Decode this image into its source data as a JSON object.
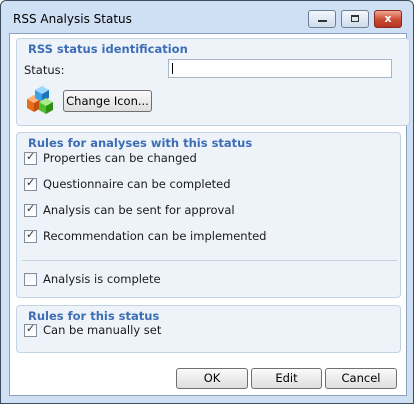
{
  "window": {
    "title": "RSS Analysis Status"
  },
  "titlebar_buttons": {
    "minimize": "–",
    "maximize": "□",
    "close": "x"
  },
  "group_identification": {
    "title": "RSS status identification",
    "status_label": "Status:",
    "status_value": "",
    "change_icon_label": "Change Icon...",
    "icon": "colored-cubes-icon"
  },
  "group_rules_analyses": {
    "title": "Rules for analyses with this status",
    "items": [
      {
        "label": "Properties can be changed",
        "checked": true
      },
      {
        "label": "Questionnaire can be completed",
        "checked": true
      },
      {
        "label": "Analysis can be sent for approval",
        "checked": true
      },
      {
        "label": "Recommendation can  be implemented",
        "checked": true
      },
      {
        "label": "Analysis is complete",
        "checked": false
      }
    ]
  },
  "group_rules_status": {
    "title": "Rules for this status",
    "items": [
      {
        "label": "Can be manually set",
        "checked": true
      }
    ]
  },
  "buttons": {
    "ok": "OK",
    "edit": "Edit",
    "cancel": "Cancel"
  },
  "check_glyph": "✓",
  "colors": {
    "accent": "#3d6eb4",
    "frame": "#cfe0f4",
    "group_bg": "#eef3fa"
  }
}
